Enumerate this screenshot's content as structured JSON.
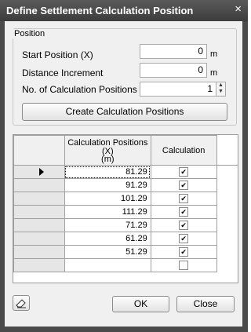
{
  "window": {
    "title": "Define Settlement Calculation Position",
    "close_glyph": "×"
  },
  "position_group": {
    "title": "Position",
    "start_label": "Start Position (X)",
    "start_value": "0",
    "start_unit": "m",
    "increment_label": "Distance Increment",
    "increment_value": "0",
    "increment_unit": "m",
    "count_label": "No. of Calculation Positions",
    "count_value": "1",
    "create_button": "Create Calculation Positions"
  },
  "grid": {
    "col_position_header": "Calculation Positions (X)\n(m)",
    "col_position_h1": "Calculation Positions",
    "col_position_h2": "(X)",
    "col_position_h3": "(m)",
    "col_calc_header": "Calculation",
    "rows": [
      {
        "x": "81.29",
        "checked": true,
        "current": true
      },
      {
        "x": "91.29",
        "checked": true
      },
      {
        "x": "101.29",
        "checked": true
      },
      {
        "x": "111.29",
        "checked": true
      },
      {
        "x": "71.29",
        "checked": true
      },
      {
        "x": "61.29",
        "checked": true
      },
      {
        "x": "51.29",
        "checked": true
      },
      {
        "x": "",
        "checked": false
      }
    ]
  },
  "footer": {
    "eraser_icon": "eraser-icon",
    "ok_label": "OK",
    "close_label": "Close"
  }
}
